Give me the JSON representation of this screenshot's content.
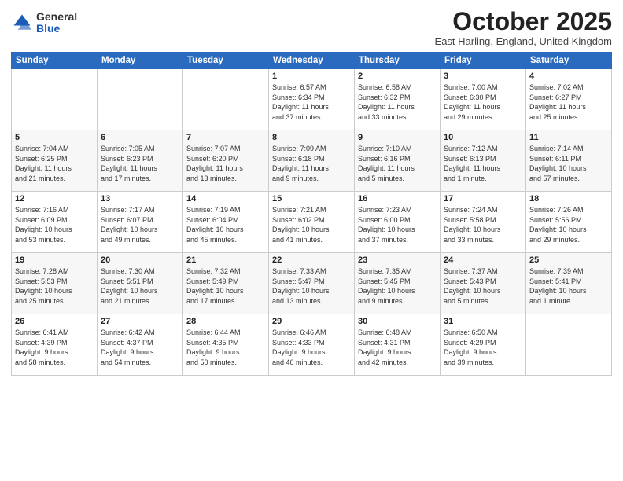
{
  "header": {
    "logo_general": "General",
    "logo_blue": "Blue",
    "month_title": "October 2025",
    "location": "East Harling, England, United Kingdom"
  },
  "weekdays": [
    "Sunday",
    "Monday",
    "Tuesday",
    "Wednesday",
    "Thursday",
    "Friday",
    "Saturday"
  ],
  "weeks": [
    [
      {
        "day": "",
        "info": ""
      },
      {
        "day": "",
        "info": ""
      },
      {
        "day": "",
        "info": ""
      },
      {
        "day": "1",
        "info": "Sunrise: 6:57 AM\nSunset: 6:34 PM\nDaylight: 11 hours\nand 37 minutes."
      },
      {
        "day": "2",
        "info": "Sunrise: 6:58 AM\nSunset: 6:32 PM\nDaylight: 11 hours\nand 33 minutes."
      },
      {
        "day": "3",
        "info": "Sunrise: 7:00 AM\nSunset: 6:30 PM\nDaylight: 11 hours\nand 29 minutes."
      },
      {
        "day": "4",
        "info": "Sunrise: 7:02 AM\nSunset: 6:27 PM\nDaylight: 11 hours\nand 25 minutes."
      }
    ],
    [
      {
        "day": "5",
        "info": "Sunrise: 7:04 AM\nSunset: 6:25 PM\nDaylight: 11 hours\nand 21 minutes."
      },
      {
        "day": "6",
        "info": "Sunrise: 7:05 AM\nSunset: 6:23 PM\nDaylight: 11 hours\nand 17 minutes."
      },
      {
        "day": "7",
        "info": "Sunrise: 7:07 AM\nSunset: 6:20 PM\nDaylight: 11 hours\nand 13 minutes."
      },
      {
        "day": "8",
        "info": "Sunrise: 7:09 AM\nSunset: 6:18 PM\nDaylight: 11 hours\nand 9 minutes."
      },
      {
        "day": "9",
        "info": "Sunrise: 7:10 AM\nSunset: 6:16 PM\nDaylight: 11 hours\nand 5 minutes."
      },
      {
        "day": "10",
        "info": "Sunrise: 7:12 AM\nSunset: 6:13 PM\nDaylight: 11 hours\nand 1 minute."
      },
      {
        "day": "11",
        "info": "Sunrise: 7:14 AM\nSunset: 6:11 PM\nDaylight: 10 hours\nand 57 minutes."
      }
    ],
    [
      {
        "day": "12",
        "info": "Sunrise: 7:16 AM\nSunset: 6:09 PM\nDaylight: 10 hours\nand 53 minutes."
      },
      {
        "day": "13",
        "info": "Sunrise: 7:17 AM\nSunset: 6:07 PM\nDaylight: 10 hours\nand 49 minutes."
      },
      {
        "day": "14",
        "info": "Sunrise: 7:19 AM\nSunset: 6:04 PM\nDaylight: 10 hours\nand 45 minutes."
      },
      {
        "day": "15",
        "info": "Sunrise: 7:21 AM\nSunset: 6:02 PM\nDaylight: 10 hours\nand 41 minutes."
      },
      {
        "day": "16",
        "info": "Sunrise: 7:23 AM\nSunset: 6:00 PM\nDaylight: 10 hours\nand 37 minutes."
      },
      {
        "day": "17",
        "info": "Sunrise: 7:24 AM\nSunset: 5:58 PM\nDaylight: 10 hours\nand 33 minutes."
      },
      {
        "day": "18",
        "info": "Sunrise: 7:26 AM\nSunset: 5:56 PM\nDaylight: 10 hours\nand 29 minutes."
      }
    ],
    [
      {
        "day": "19",
        "info": "Sunrise: 7:28 AM\nSunset: 5:53 PM\nDaylight: 10 hours\nand 25 minutes."
      },
      {
        "day": "20",
        "info": "Sunrise: 7:30 AM\nSunset: 5:51 PM\nDaylight: 10 hours\nand 21 minutes."
      },
      {
        "day": "21",
        "info": "Sunrise: 7:32 AM\nSunset: 5:49 PM\nDaylight: 10 hours\nand 17 minutes."
      },
      {
        "day": "22",
        "info": "Sunrise: 7:33 AM\nSunset: 5:47 PM\nDaylight: 10 hours\nand 13 minutes."
      },
      {
        "day": "23",
        "info": "Sunrise: 7:35 AM\nSunset: 5:45 PM\nDaylight: 10 hours\nand 9 minutes."
      },
      {
        "day": "24",
        "info": "Sunrise: 7:37 AM\nSunset: 5:43 PM\nDaylight: 10 hours\nand 5 minutes."
      },
      {
        "day": "25",
        "info": "Sunrise: 7:39 AM\nSunset: 5:41 PM\nDaylight: 10 hours\nand 1 minute."
      }
    ],
    [
      {
        "day": "26",
        "info": "Sunrise: 6:41 AM\nSunset: 4:39 PM\nDaylight: 9 hours\nand 58 minutes."
      },
      {
        "day": "27",
        "info": "Sunrise: 6:42 AM\nSunset: 4:37 PM\nDaylight: 9 hours\nand 54 minutes."
      },
      {
        "day": "28",
        "info": "Sunrise: 6:44 AM\nSunset: 4:35 PM\nDaylight: 9 hours\nand 50 minutes."
      },
      {
        "day": "29",
        "info": "Sunrise: 6:46 AM\nSunset: 4:33 PM\nDaylight: 9 hours\nand 46 minutes."
      },
      {
        "day": "30",
        "info": "Sunrise: 6:48 AM\nSunset: 4:31 PM\nDaylight: 9 hours\nand 42 minutes."
      },
      {
        "day": "31",
        "info": "Sunrise: 6:50 AM\nSunset: 4:29 PM\nDaylight: 9 hours\nand 39 minutes."
      },
      {
        "day": "",
        "info": ""
      }
    ]
  ]
}
